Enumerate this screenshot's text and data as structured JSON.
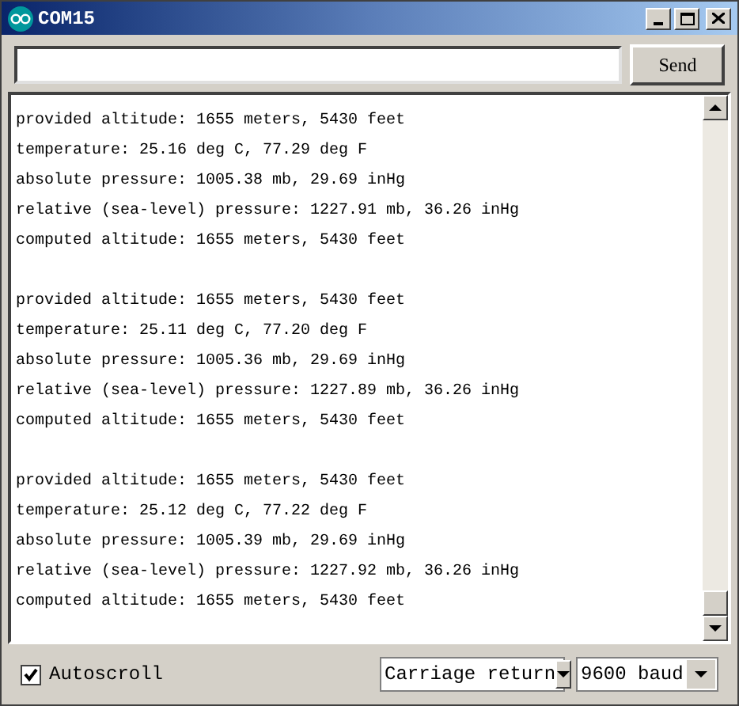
{
  "window": {
    "title": "COM15"
  },
  "send_button": {
    "label": "Send"
  },
  "output": {
    "groups": [
      {
        "lines": [
          "provided altitude: 1655 meters, 5430 feet",
          "temperature: 25.16 deg C, 77.29 deg F",
          "absolute pressure: 1005.38 mb, 29.69 inHg",
          "relative (sea-level) pressure: 1227.91 mb, 36.26 inHg",
          "computed altitude: 1655 meters, 5430 feet"
        ]
      },
      {
        "lines": [
          "provided altitude: 1655 meters, 5430 feet",
          "temperature: 25.11 deg C, 77.20 deg F",
          "absolute pressure: 1005.36 mb, 29.69 inHg",
          "relative (sea-level) pressure: 1227.89 mb, 36.26 inHg",
          "computed altitude: 1655 meters, 5430 feet"
        ]
      },
      {
        "lines": [
          "provided altitude: 1655 meters, 5430 feet",
          "temperature: 25.12 deg C, 77.22 deg F",
          "absolute pressure: 1005.39 mb, 29.69 inHg",
          "relative (sea-level) pressure: 1227.92 mb, 36.26 inHg",
          "computed altitude: 1655 meters, 5430 feet"
        ]
      }
    ]
  },
  "autoscroll": {
    "label": "Autoscroll",
    "checked": true
  },
  "line_ending": {
    "value": "Carriage return"
  },
  "baud": {
    "value": "9600 baud"
  }
}
